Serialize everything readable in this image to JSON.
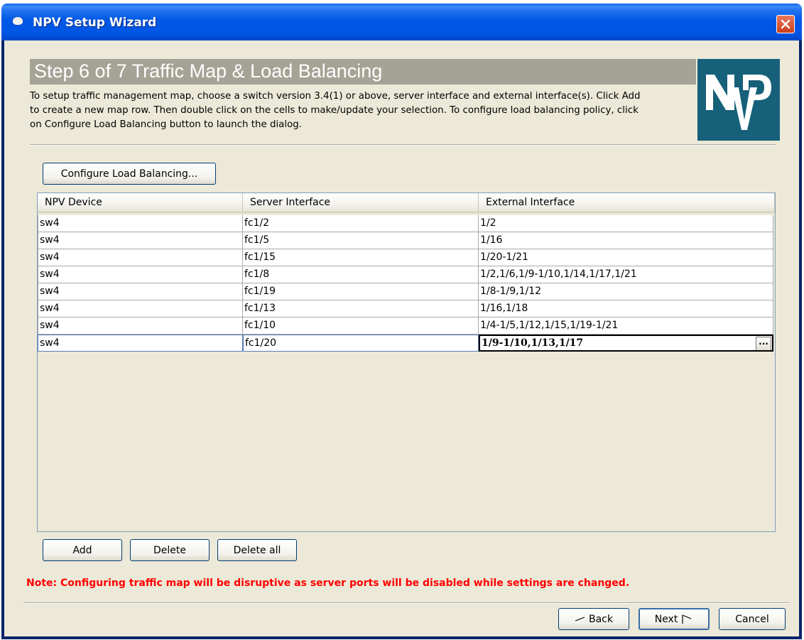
{
  "window": {
    "title": "NPV Setup Wizard"
  },
  "header": {
    "step_title": "Step 6 of 7 Traffic Map & Load Balancing",
    "intro_lines": [
      "To setup traffic management map, choose a switch version 3.4(1) or above, server interface and external interface(s).  Click Add",
      "to create a new map row.  Then double click on the cells to make/update your selection.  To configure load balancing policy, click",
      "on Configure Load Balancing button to launch the dialog."
    ],
    "logo_text": "NPV"
  },
  "toolbar": {
    "configure_load_balancing_label": "Configure Load Balancing..."
  },
  "table": {
    "columns": [
      "NPV Device",
      "Server Interface",
      "External Interface"
    ],
    "rows": [
      [
        "sw4",
        "fc1/2",
        "1/2"
      ],
      [
        "sw4",
        "fc1/5",
        "1/16"
      ],
      [
        "sw4",
        "fc1/15",
        "1/20-1/21"
      ],
      [
        "sw4",
        "fc1/8",
        "1/2,1/6,1/9-1/10,1/14,1/17,1/21"
      ],
      [
        "sw4",
        "fc1/19",
        "1/8-1/9,1/12"
      ],
      [
        "sw4",
        "fc1/13",
        "1/16,1/18"
      ],
      [
        "sw4",
        "fc1/10",
        "1/4-1/5,1/12,1/15,1/19-1/21"
      ],
      [
        "sw4",
        "fc1/20",
        "1/9-1/10,1/13,1/17"
      ]
    ],
    "ellipsis_label": "..."
  },
  "row_actions": {
    "add_label": "Add",
    "delete_label": "Delete",
    "delete_all_label": "Delete all"
  },
  "note": "Note: Configuring traffic map will be disruptive as server ports will be disabled while settings are changed.",
  "nav": {
    "back_label": "Back",
    "next_label": "Next",
    "cancel_label": "Cancel"
  },
  "colors": {
    "titlebar": "#0058e6",
    "client_bg": "#ece9d8",
    "banner": "#a5a396",
    "logo_bg": "#16607a",
    "note": "#ff0000"
  }
}
